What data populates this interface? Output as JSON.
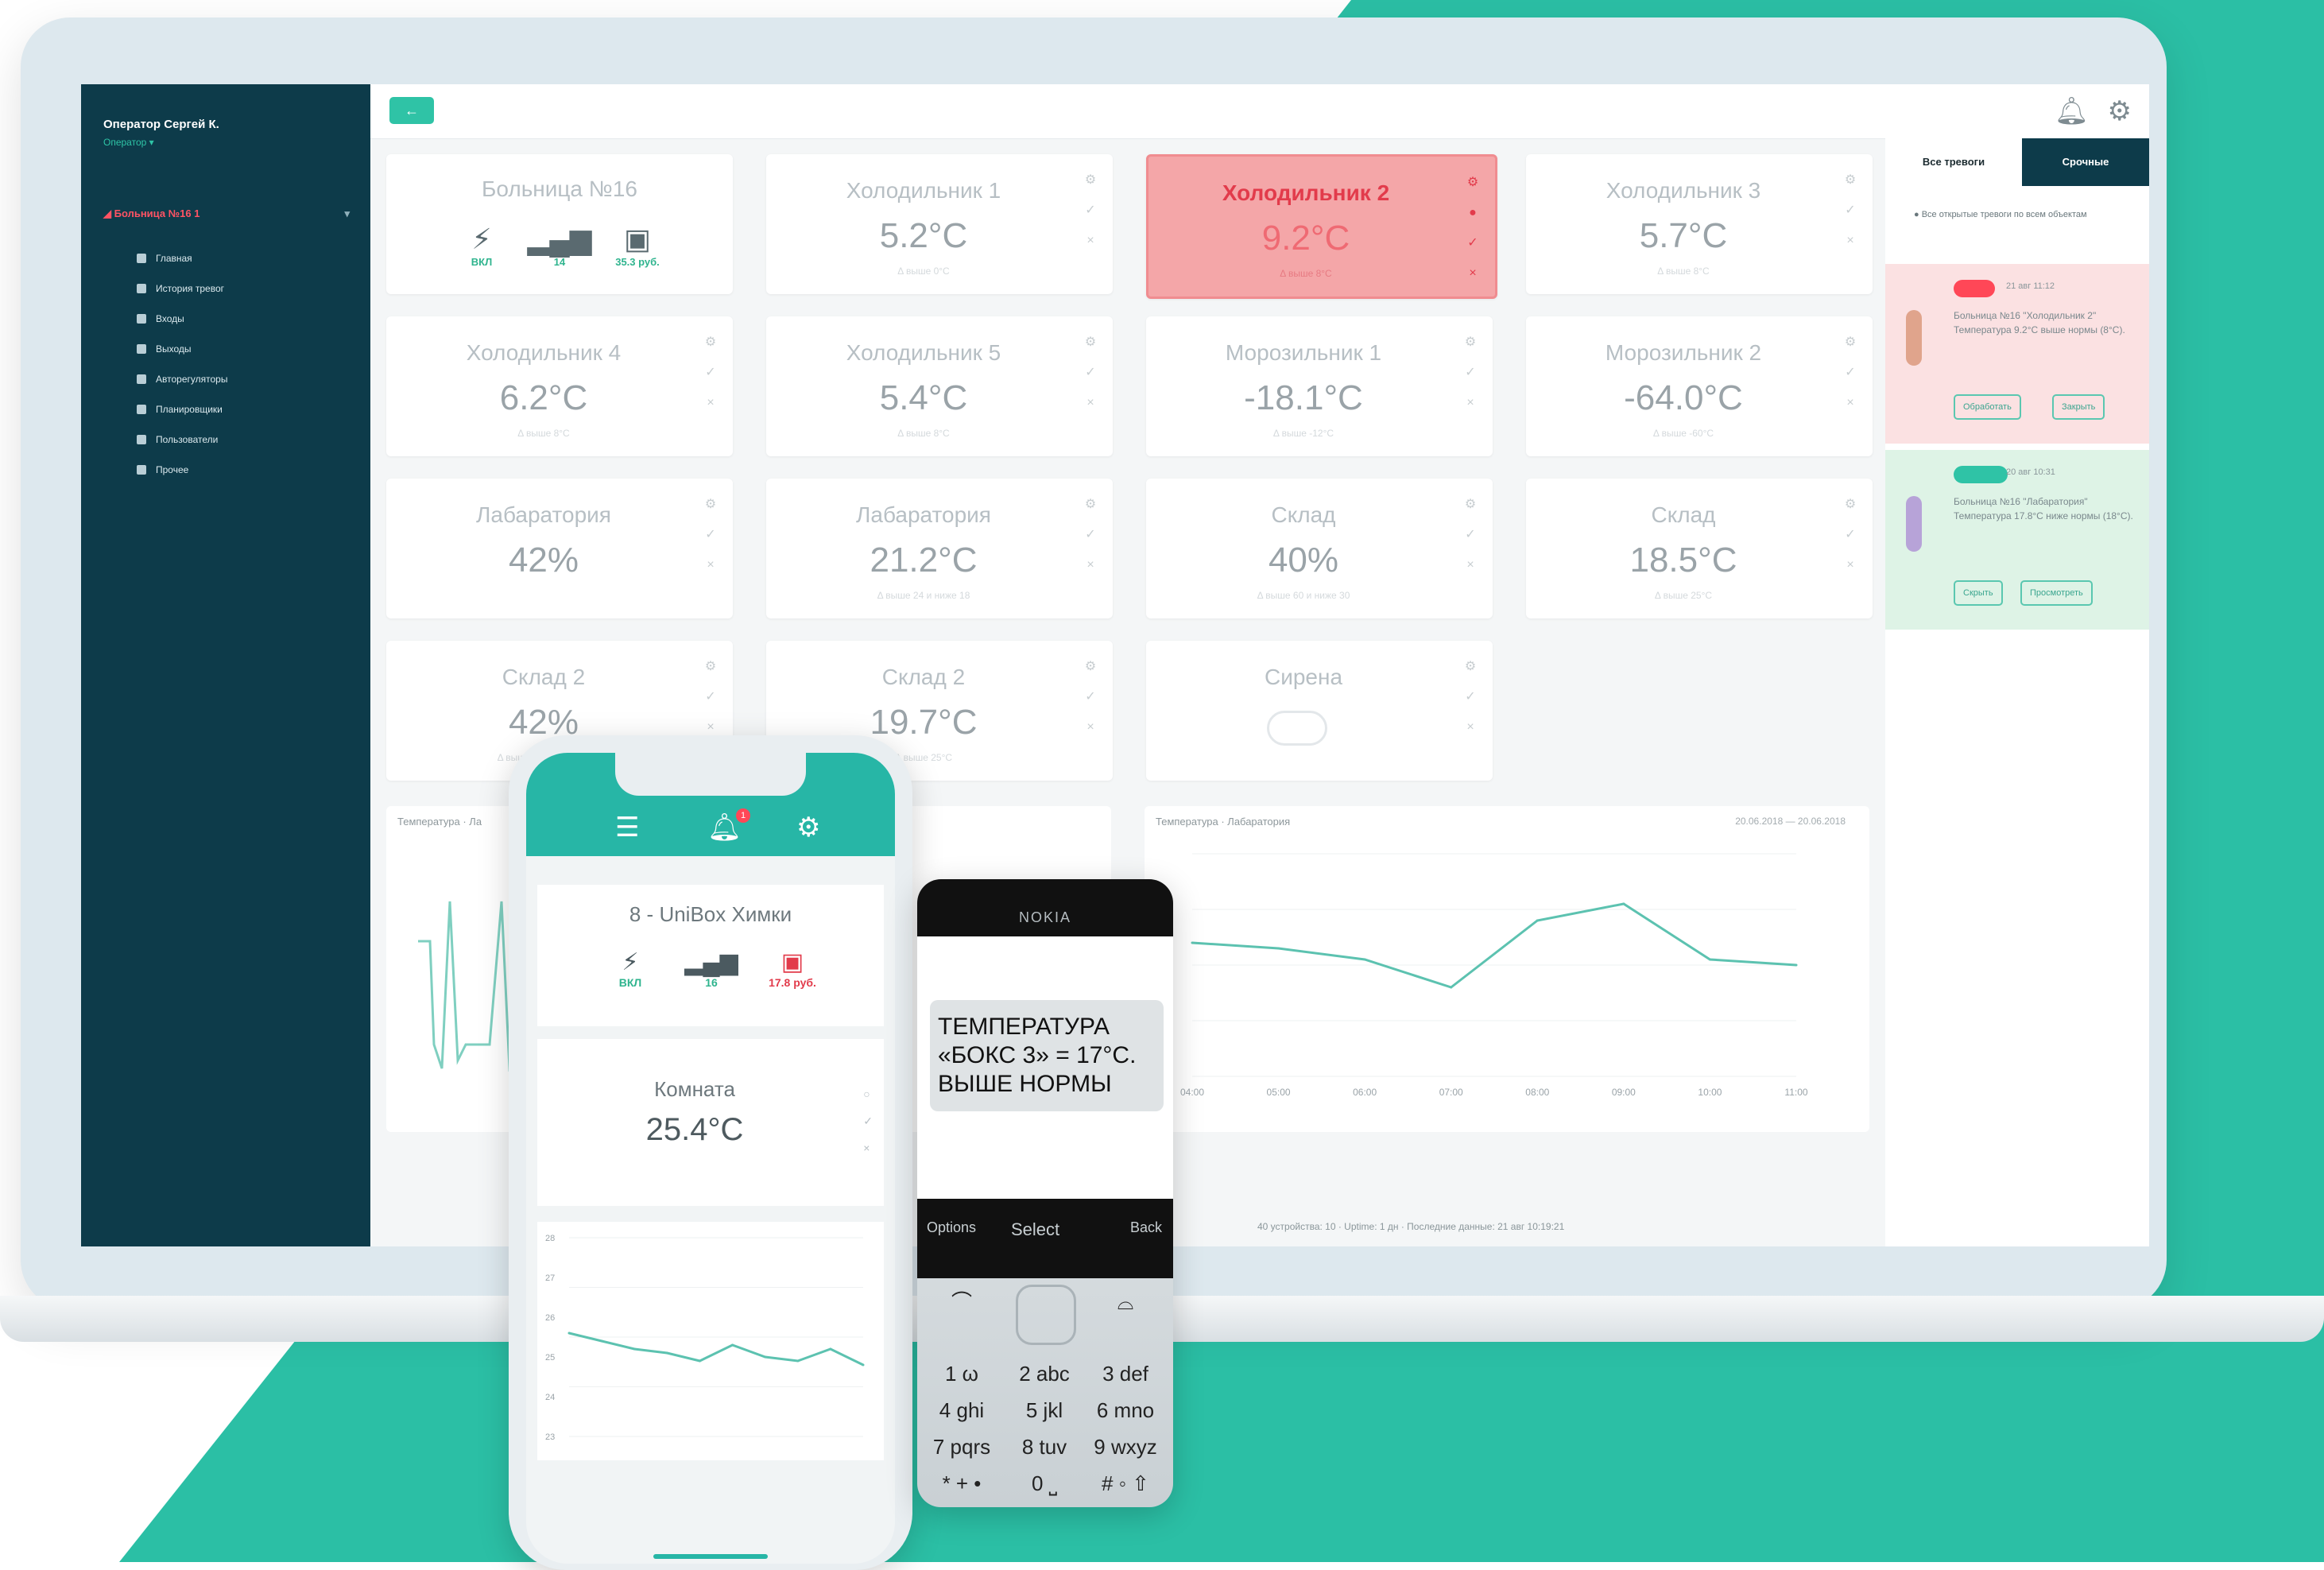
{
  "sidebar": {
    "operator_name": "Оператор Сергей К.",
    "operator_role": "Оператор ▾",
    "object": "Больница №16",
    "object_count": "1",
    "nav": [
      {
        "icon": "grid-icon",
        "label": "Главная"
      },
      {
        "icon": "bell-icon",
        "label": "История тревог"
      },
      {
        "icon": "login-icon",
        "label": "Входы"
      },
      {
        "icon": "logout-icon",
        "label": "Выходы"
      },
      {
        "icon": "robot-icon",
        "label": "Авторегуляторы"
      },
      {
        "icon": "calendar-icon",
        "label": "Планировщики"
      },
      {
        "icon": "users-icon",
        "label": "Пользователи"
      },
      {
        "icon": "gear-icon",
        "label": "Прочее"
      }
    ]
  },
  "cards": [
    {
      "title": "Больница №16",
      "type": "hospital",
      "stats": [
        {
          "icon": "plug-icon",
          "value": "ВКЛ"
        },
        {
          "icon": "signal-icon",
          "value": "14"
        },
        {
          "icon": "money-icon",
          "value": "35.3 руб."
        }
      ]
    },
    {
      "title": "Холодильник 1",
      "value": "5.2°C",
      "sub": "Δ выше 0°C"
    },
    {
      "title": "Холодильник 2",
      "value": "9.2°C",
      "sub": "Δ выше 8°C",
      "alarm": true
    },
    {
      "title": "Холодильник 3",
      "value": "5.7°C",
      "sub": "Δ выше 8°C"
    },
    {
      "title": "Холодильник 4",
      "value": "6.2°C",
      "sub": "Δ выше 8°C"
    },
    {
      "title": "Холодильник 5",
      "value": "5.4°C",
      "sub": "Δ выше 8°C"
    },
    {
      "title": "Морозильник 1",
      "value": "-18.1°C",
      "sub": "Δ выше -12°C"
    },
    {
      "title": "Морозильник 2",
      "value": "-64.0°C",
      "sub": "Δ выше -60°C"
    },
    {
      "title": "Лабаратория",
      "value": "42%",
      "sub": ""
    },
    {
      "title": "Лабаратория",
      "value": "21.2°C",
      "sub": "Δ выше 24 и ниже 18"
    },
    {
      "title": "Склад",
      "value": "40%",
      "sub": "Δ выше 60 и ниже 30"
    },
    {
      "title": "Склад",
      "value": "18.5°C",
      "sub": "Δ выше 25°C"
    },
    {
      "title": "Склад 2",
      "value": "42%",
      "sub": "Δ выше 60 и ниже 30"
    },
    {
      "title": "Склад 2",
      "value": "19.7°C",
      "sub": "Δ выше 25°C"
    },
    {
      "title": "Сирена",
      "type": "toggle",
      "state": "off"
    }
  ],
  "charts": {
    "left": {
      "title": "Температура · Ла"
    },
    "right": {
      "title": "Температура · Лабаратория",
      "dates": "20.06.2018 — 20.06.2018"
    }
  },
  "chart_data": [
    {
      "type": "line",
      "title": "Температура · Лабаратория",
      "x": [
        "04:00",
        "05:00",
        "06:00",
        "07:00",
        "08:00",
        "09:00",
        "10:00",
        "11:00"
      ],
      "values": [
        21.4,
        21.3,
        21.1,
        20.6,
        21.8,
        22.1,
        21.1,
        21.0
      ],
      "ylim": [
        19,
        23
      ]
    },
    {
      "type": "line",
      "title": "",
      "y_ticks": [
        "28",
        "27",
        "26",
        "25",
        "24",
        "23"
      ],
      "values": [
        25.6,
        25.4,
        25.2,
        25.1,
        24.9,
        25.3,
        25.0,
        24.9,
        25.2,
        24.8
      ],
      "ylim": [
        23,
        28
      ]
    }
  ],
  "alerts": {
    "tab_all": "Все тревоги",
    "tab_urgent": "Срочные",
    "note": "Все открытые тревоги по всем объектам",
    "items": [
      {
        "color": "#ff4757",
        "time": "21 авг 11:12",
        "text": "Больница №16 \"Холодильник 2\" Температура 9.2°C выше нормы (8°C).",
        "buttons": [
          "Обработать",
          "Закрыть"
        ]
      },
      {
        "color": "#2fc3a6",
        "time": "20 авг 10:31",
        "text": "Больница №16 \"Лабаратория\" Температура 17.8°C ниже нормы (18°C).",
        "buttons": [
          "Скрыть",
          "Просмотреть"
        ]
      }
    ]
  },
  "status": "40 устройства: 10  ·  Uptime: 1 дн  ·  Последние данные: 21 авг 10:19:21",
  "phone": {
    "device": "8 - UniBox Химки",
    "stats": [
      {
        "icon": "plug-icon",
        "value": "ВКЛ"
      },
      {
        "icon": "signal-icon",
        "value": "16"
      },
      {
        "icon": "money-icon",
        "value": "17.8 руб."
      }
    ],
    "notif_count": "1",
    "room": "Комната",
    "room_value": "25.4°C"
  },
  "nokia": {
    "brand": "NOKIA",
    "message": "ТЕМПЕРАТУРА «БОКС 3» = 17°C. ВЫШЕ НОРМЫ",
    "soft_left": "Options",
    "soft_mid": "Select",
    "soft_right": "Back",
    "keys": [
      "1 ω",
      "2 abc",
      "3 def",
      "4 ghi",
      "5 jkl",
      "6 mno",
      "7 pqrs",
      "8 tuv",
      "9 wxyz",
      "* + •",
      "0 ⎵",
      "# ◦ ⇧"
    ]
  },
  "colors": {
    "teal": "#2fc3a6",
    "navy": "#0d3b4a",
    "alarm": "#e23b4b"
  }
}
